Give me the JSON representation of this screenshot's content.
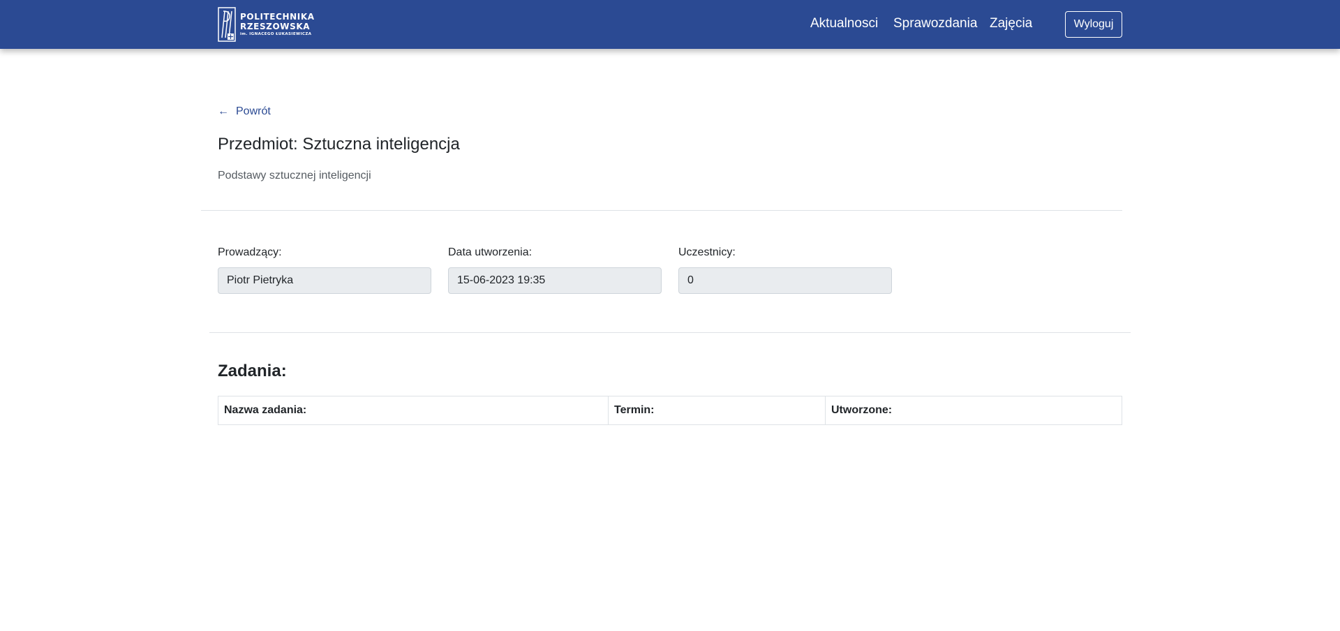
{
  "header": {
    "logo": {
      "line1": "POLITECHNIKA",
      "line2": "RZESZOWSKA",
      "line3": "im. IGNACEGO ŁUKASIEWICZA"
    },
    "nav": {
      "aktualnosci": "Aktualnosci",
      "sprawozdania": "Sprawozdania",
      "zajecia": "Zajęcia"
    },
    "logout_label": "Wyloguj",
    "brand_color": "#2b4a93"
  },
  "back_label": "Powrót",
  "subject": {
    "title": "Przedmiot: Sztuczna inteligencja",
    "description": "Podstawy sztucznej inteligencji"
  },
  "fields": {
    "teacher": {
      "label": "Prowadzący:",
      "value": "Piotr Pietryka"
    },
    "created": {
      "label": "Data utworzenia:",
      "value": "15-06-2023 19:35"
    },
    "participants": {
      "label": "Uczestnicy:",
      "value": "0"
    }
  },
  "tasks": {
    "title": "Zadania:",
    "columns": [
      "Nazwa zadania:",
      "Termin:",
      "Utworzone:"
    ],
    "rows": []
  },
  "icons": {
    "back": "arrow-left-icon",
    "logo": "politechnika-logo-icon"
  }
}
